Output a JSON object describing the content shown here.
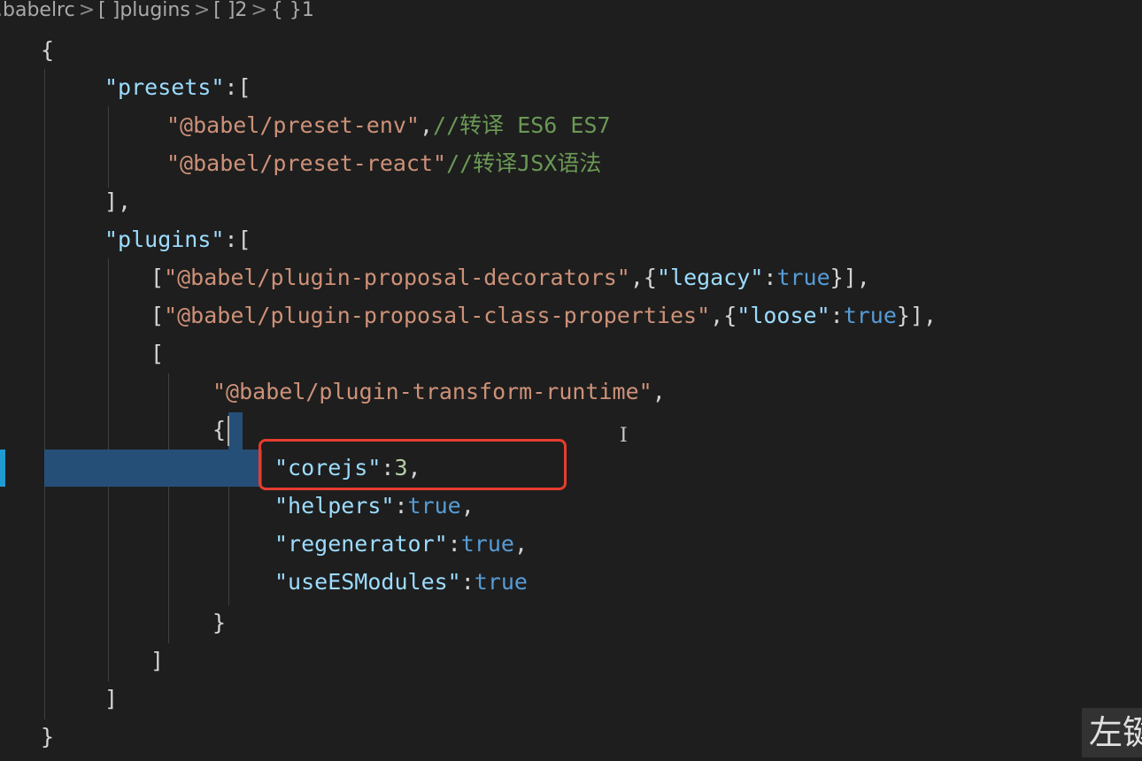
{
  "breadcrumb": {
    "items": [
      ".babelrc",
      "[ ]plugins",
      "[ ]2",
      "{ }1"
    ],
    "separator": ">"
  },
  "code": {
    "open_brace": "{",
    "presets_key": "\"presets\"",
    "presets_open": ":[",
    "preset_env": "\"@babel/preset-env\"",
    "preset_env_comma": ",",
    "preset_env_comment": "//转译 ES6 ES7",
    "preset_react": "\"@babel/preset-react\"",
    "preset_react_comment": "//转译JSX语法",
    "presets_close": "],",
    "plugins_key": "\"plugins\"",
    "plugins_open": ":[",
    "decorators_open": "[",
    "decorators_name": "\"@babel/plugin-proposal-decorators\"",
    "decorators_mid": ",{",
    "legacy_key": "\"legacy\"",
    "colon": ":",
    "legacy_val": "true",
    "decorators_close": "}],",
    "classprops_open": "[",
    "classprops_name": "\"@babel/plugin-proposal-class-properties\"",
    "classprops_mid": ",{",
    "loose_key": "\"loose\"",
    "loose_val": "true",
    "classprops_close": "}],",
    "runtime_array_open": "[",
    "runtime_name": "\"@babel/plugin-transform-runtime\"",
    "runtime_comma": ",",
    "options_open": "{",
    "corejs_key": "\"corejs\"",
    "corejs_val": "3",
    "corejs_comma": ",",
    "helpers_key": "\"helpers\"",
    "helpers_val": "true",
    "helpers_comma": ",",
    "regenerator_key": "\"regenerator\"",
    "regenerator_val": "true",
    "regenerator_comma": ",",
    "useesmodules_key": "\"useESModules\"",
    "useesmodules_val": "true",
    "options_close": "}",
    "runtime_array_close": "]",
    "plugins_close": "]",
    "close_brace": "}"
  },
  "watermark": {
    "text": "左键"
  },
  "colors": {
    "background": "#1e1e1e",
    "string": "#ce9178",
    "key": "#9cdcfe",
    "boolean": "#569cd6",
    "number": "#b5cea8",
    "comment": "#6a9955",
    "highlight_box": "#e53c2f",
    "selection": "#264f78"
  }
}
